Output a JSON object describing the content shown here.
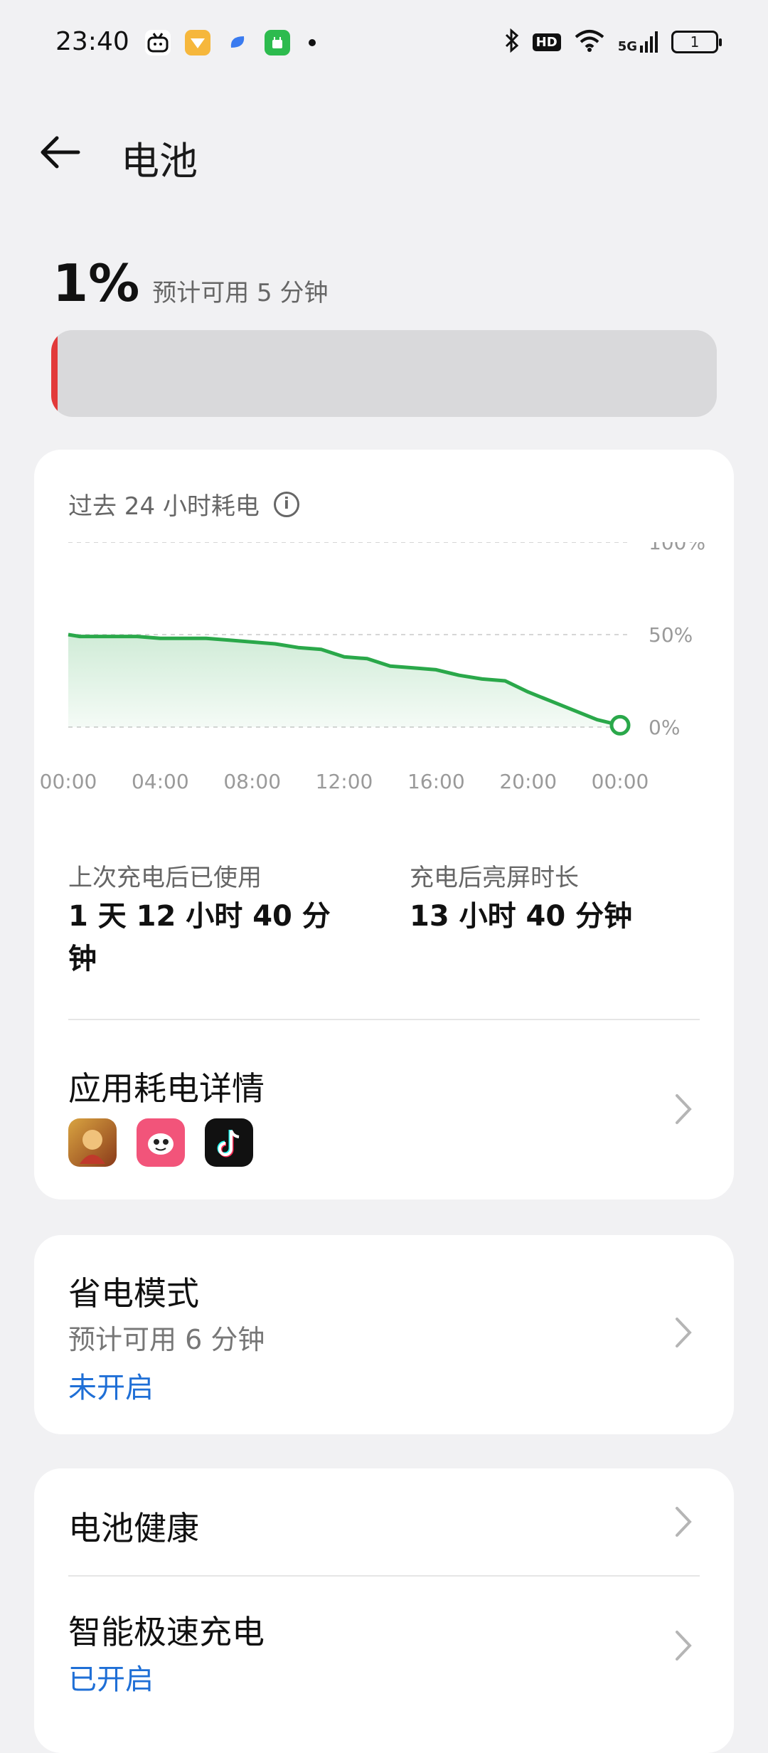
{
  "status_bar": {
    "time": "23:40",
    "left_icons": [
      "tv-app-icon",
      "yellow-app-icon",
      "blue-app-icon",
      "green-app-icon"
    ],
    "right_icons": [
      "bluetooth-icon",
      "hd-icon",
      "wifi-icon",
      "5g-signal-icon",
      "battery-icon"
    ],
    "hd": "HD",
    "network": "5G",
    "battery_level": "1"
  },
  "header": {
    "title": "电池"
  },
  "battery": {
    "percent": "1%",
    "estimate": "预计可用 5 分钟",
    "level_fraction": 0.01,
    "bar_color": "#e23a3a"
  },
  "usage": {
    "heading": "过去 24 小时耗电",
    "since_charge_label": "上次充电后已使用",
    "since_charge_value": "1 天 12 小时 40 分钟",
    "screen_on_label": "充电后亮屏时长",
    "screen_on_value": "13 小时 40 分钟",
    "app_details_title": "应用耗电详情",
    "apps": [
      "game-app-icon",
      "emoji-app-icon",
      "tiktok-app-icon"
    ]
  },
  "chart_data": {
    "type": "area",
    "x_labels": [
      "00:00",
      "04:00",
      "08:00",
      "12:00",
      "16:00",
      "20:00",
      "00:00"
    ],
    "y_labels": [
      "100%",
      "50%",
      "0%"
    ],
    "ylim": [
      0,
      100
    ],
    "grid": true,
    "series": [
      {
        "color": "#2aa84a",
        "x": [
          0,
          0.5,
          1,
          2,
          3,
          4,
          5,
          6,
          7,
          8,
          9,
          10,
          11,
          12,
          13,
          14,
          15,
          16,
          17,
          18,
          19,
          20,
          21,
          22,
          23,
          24
        ],
        "y": [
          50,
          49,
          49,
          49,
          49,
          48,
          48,
          48,
          47,
          46,
          45,
          43,
          42,
          38,
          37,
          33,
          32,
          31,
          28,
          26,
          25,
          19,
          14,
          9,
          4,
          1
        ]
      }
    ]
  },
  "saver": {
    "title": "省电模式",
    "estimate": "预计可用 6 分钟",
    "status": "未开启"
  },
  "health": {
    "title": "电池健康",
    "fast_charge_title": "智能极速充电",
    "fast_charge_status": "已开启"
  },
  "colors": {
    "accent": "#1f6fd6",
    "chart_line": "#2aa84a",
    "background": "#f1f1f3"
  }
}
